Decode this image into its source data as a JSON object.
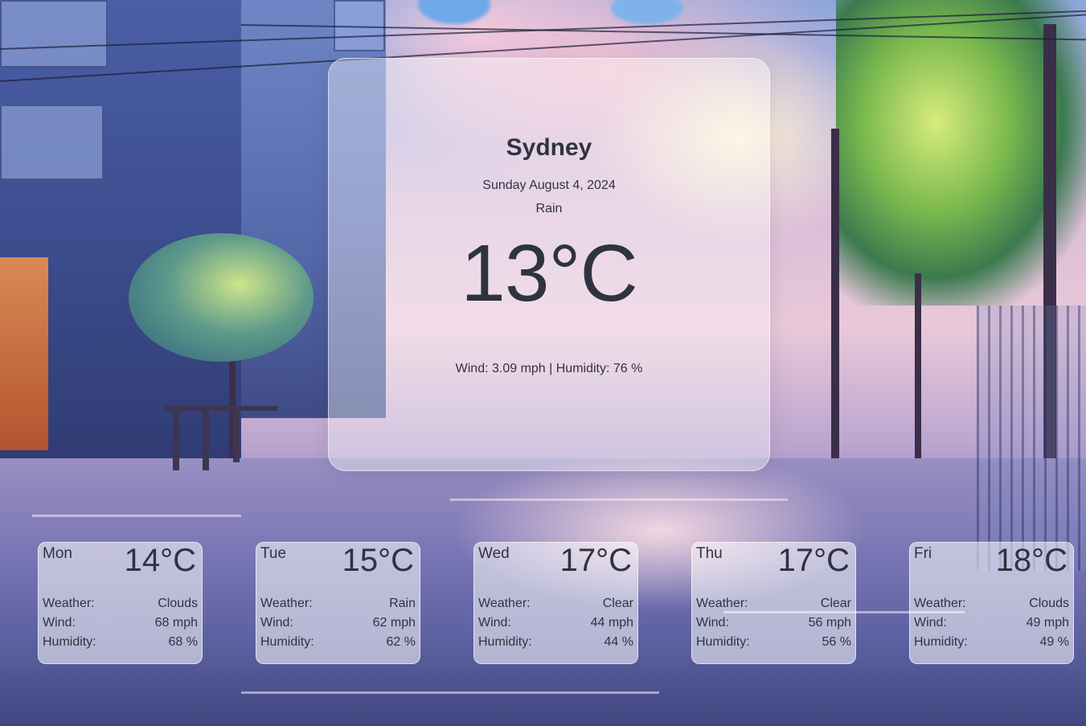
{
  "current": {
    "city": "Sydney",
    "date": "Sunday August 4, 2024",
    "condition": "Rain",
    "temperature": "13°C",
    "details": "Wind: 3.09 mph | Humidity: 76 %"
  },
  "forecast_labels": {
    "weather": "Weather:",
    "wind": "Wind:",
    "humidity": "Humidity:"
  },
  "forecast": [
    {
      "day": "Mon",
      "temp": "14°C",
      "weather": "Clouds",
      "wind": "68 mph",
      "humidity": "68 %"
    },
    {
      "day": "Tue",
      "temp": "15°C",
      "weather": "Rain",
      "wind": "62 mph",
      "humidity": "62 %"
    },
    {
      "day": "Wed",
      "temp": "17°C",
      "weather": "Clear",
      "wind": "44 mph",
      "humidity": "44 %"
    },
    {
      "day": "Thu",
      "temp": "17°C",
      "weather": "Clear",
      "wind": "56 mph",
      "humidity": "56 %"
    },
    {
      "day": "Fri",
      "temp": "18°C",
      "weather": "Clouds",
      "wind": "49 mph",
      "humidity": "49 %"
    }
  ],
  "theme": {
    "text_color": "#2f3340",
    "card_background": "rgba(255,255,255,0.38)"
  }
}
